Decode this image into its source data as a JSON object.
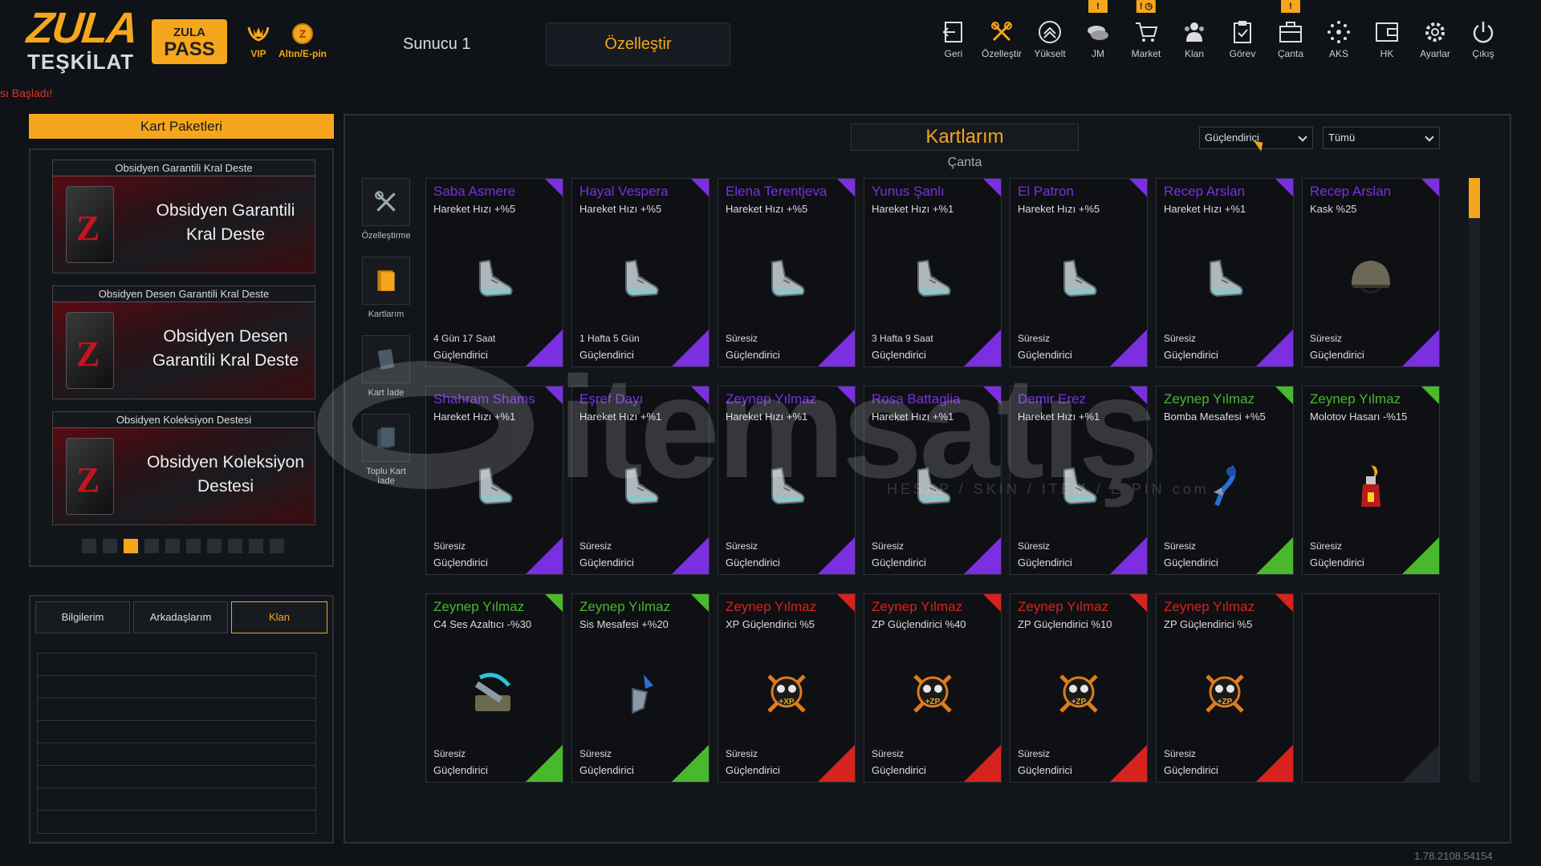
{
  "header": {
    "logo_main": "ZULA",
    "logo_sub": "TEŞKİLAT",
    "pass_line1": "ZULA",
    "pass_line2": "PASS",
    "vip_label": "VIP",
    "gold_label": "Altın/E-pin",
    "server": "Sunucu 1",
    "customize": "Özelleştir",
    "started_msg": "sı Başladı!",
    "nav": [
      {
        "label": "Geri",
        "icon": "back-icon",
        "badge": ""
      },
      {
        "label": "Özelleştir",
        "icon": "tools-icon",
        "badge": ""
      },
      {
        "label": "Yükselt",
        "icon": "upgrade-icon",
        "badge": ""
      },
      {
        "label": "JM",
        "icon": "coins-icon",
        "badge": "!"
      },
      {
        "label": "Market",
        "icon": "cart-icon",
        "badge": "! ◷"
      },
      {
        "label": "Klan",
        "icon": "clan-icon",
        "badge": ""
      },
      {
        "label": "Görev",
        "icon": "task-icon",
        "badge": ""
      },
      {
        "label": "Çanta",
        "icon": "bag-icon",
        "badge": "!"
      },
      {
        "label": "AKS",
        "icon": "aks-icon",
        "badge": ""
      },
      {
        "label": "HK",
        "icon": "wallet-icon",
        "badge": ""
      },
      {
        "label": "Ayarlar",
        "icon": "gear-icon",
        "badge": ""
      },
      {
        "label": "Çıkış",
        "icon": "power-icon",
        "badge": ""
      }
    ]
  },
  "left": {
    "title": "Kart Paketleri",
    "packs": [
      {
        "header": "Obsidyen Garantili Kral Deste",
        "name1": "Obsidyen Garantili",
        "name2": "Kral Deste"
      },
      {
        "header": "Obsidyen Desen Garantili Kral Deste",
        "name1": "Obsidyen Desen",
        "name2": "Garantili Kral Deste"
      },
      {
        "header": "Obsidyen Koleksiyon Destesi",
        "name1": "Obsidyen Koleksiyon",
        "name2": "Destesi"
      }
    ],
    "pager_count": 10,
    "pager_active": 2,
    "tabs": [
      "Bilgilerim",
      "Arkadaşlarım",
      "Klan"
    ],
    "active_tab": 2
  },
  "main": {
    "title": "Kartlarım",
    "subtitle": "Çanta",
    "filter1": "Güçlendirici",
    "filter2": "Tümü",
    "tools": [
      "Özelleştirme",
      "Kartlarım",
      "Kart İade",
      "Toplu Kart İade"
    ],
    "colors": {
      "purple": "#7b2fe0",
      "green": "#49b82c",
      "red": "#d7231d",
      "accent": "#f5a61c"
    },
    "cards": [
      {
        "name": "Saba Asmere",
        "stat": "Hareket Hızı +%5",
        "duration": "4 Gün 17 Saat",
        "type": "Güçlendirici",
        "rarity": "purple",
        "icon": "boot-icon"
      },
      {
        "name": "Hayal Vespera",
        "stat": "Hareket Hızı +%5",
        "duration": "1 Hafta 5 Gün",
        "type": "Güçlendirici",
        "rarity": "purple",
        "icon": "boot-icon"
      },
      {
        "name": "Elena Terentjeva",
        "stat": "Hareket Hızı +%5",
        "duration": "Süresiz",
        "type": "Güçlendirici",
        "rarity": "purple",
        "icon": "boot-icon"
      },
      {
        "name": "Yunus Şanlı",
        "stat": "Hareket Hızı +%1",
        "duration": "3 Hafta 9 Saat",
        "type": "Güçlendirici",
        "rarity": "purple",
        "icon": "boot-icon"
      },
      {
        "name": "El Patron",
        "stat": "Hareket Hızı +%5",
        "duration": "Süresiz",
        "type": "Güçlendirici",
        "rarity": "purple",
        "icon": "boot-icon"
      },
      {
        "name": "Recep Arslan",
        "stat": "Hareket Hızı +%1",
        "duration": "Süresiz",
        "type": "Güçlendirici",
        "rarity": "purple",
        "icon": "boot-icon"
      },
      {
        "name": "Recep Arslan",
        "stat": "Kask %25",
        "duration": "Süresiz",
        "type": "Güçlendirici",
        "rarity": "purple",
        "icon": "helmet-icon"
      },
      {
        "name": "Shahram Shams",
        "stat": "Hareket Hızı +%1",
        "duration": "Süresiz",
        "type": "Güçlendirici",
        "rarity": "purple",
        "icon": "boot-icon"
      },
      {
        "name": "Eşref Dayı",
        "stat": "Hareket Hızı +%1",
        "duration": "Süresiz",
        "type": "Güçlendirici",
        "rarity": "purple",
        "icon": "boot-icon"
      },
      {
        "name": "Zeynep Yılmaz",
        "stat": "Hareket Hızı +%1",
        "duration": "Süresiz",
        "type": "Güçlendirici",
        "rarity": "purple",
        "icon": "boot-icon"
      },
      {
        "name": "Rosa Battaglia",
        "stat": "Hareket Hızı +%1",
        "duration": "Süresiz",
        "type": "Güçlendirici",
        "rarity": "purple",
        "icon": "boot-icon"
      },
      {
        "name": "Demir Erez",
        "stat": "Hareket Hızı +%1",
        "duration": "Süresiz",
        "type": "Güçlendirici",
        "rarity": "purple",
        "icon": "boot-icon"
      },
      {
        "name": "Zeynep Yılmaz",
        "stat": "Bomba Mesafesi +%5",
        "duration": "Süresiz",
        "type": "Güçlendirici",
        "rarity": "green",
        "icon": "throw-icon"
      },
      {
        "name": "Zeynep Yılmaz",
        "stat": "Molotov Hasarı -%15",
        "duration": "Süresiz",
        "type": "Güçlendirici",
        "rarity": "green",
        "icon": "molotov-icon"
      },
      {
        "name": "Zeynep Yılmaz",
        "stat": "C4 Ses Azaltıcı -%30",
        "duration": "Süresiz",
        "type": "Güçlendirici",
        "rarity": "green",
        "icon": "c4-icon"
      },
      {
        "name": "Zeynep Yılmaz",
        "stat": "Sis Mesafesi +%20",
        "duration": "Süresiz",
        "type": "Güçlendirici",
        "rarity": "green",
        "icon": "smoke-icon"
      },
      {
        "name": "Zeynep Yılmaz",
        "stat": "XP Güçlendirici %5",
        "duration": "Süresiz",
        "type": "Güçlendirici",
        "rarity": "red",
        "icon": "xp-skull-icon",
        "emblem": "+XP"
      },
      {
        "name": "Zeynep Yılmaz",
        "stat": "ZP Güçlendirici %40",
        "duration": "Süresiz",
        "type": "Güçlendirici",
        "rarity": "red",
        "icon": "zp-skull-icon",
        "emblem": "+ZP"
      },
      {
        "name": "Zeynep Yılmaz",
        "stat": "ZP Güçlendirici %10",
        "duration": "Süresiz",
        "type": "Güçlendirici",
        "rarity": "red",
        "icon": "zp-skull-icon",
        "emblem": "+ZP"
      },
      {
        "name": "Zeynep Yılmaz",
        "stat": "ZP Güçlendirici %5",
        "duration": "Süresiz",
        "type": "Güçlendirici",
        "rarity": "red",
        "icon": "zp-skull-icon",
        "emblem": "+ZP"
      },
      {
        "name": "",
        "stat": "",
        "duration": "",
        "type": "",
        "rarity": "empty",
        "icon": ""
      }
    ]
  },
  "watermark": {
    "text": "itemsatış",
    "sub": "HESAP / SKIN / ITEM / E-PIN",
    "suffix": "com"
  },
  "version": "1.78.2108.54154"
}
